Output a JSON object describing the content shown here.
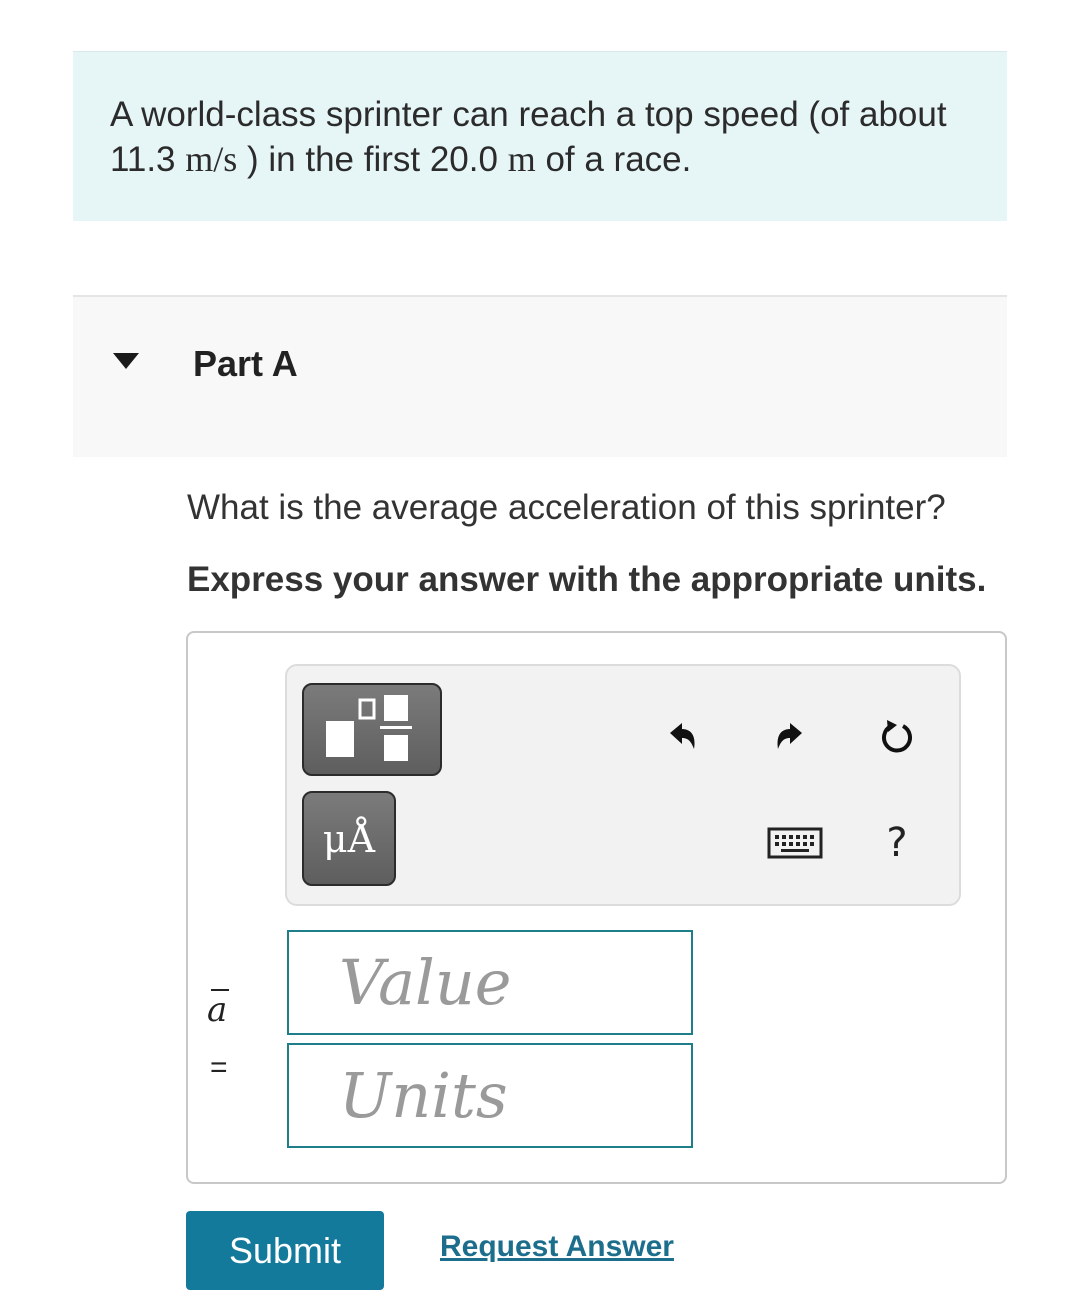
{
  "problem": {
    "text_1": "A world-class sprinter can reach a top speed (of about 11.3",
    "unit_speed": "m/s",
    "text_2": ") in the first 20.0",
    "unit_m": "m",
    "text_3": "of a race."
  },
  "part": {
    "title": "Part A"
  },
  "question": {
    "prompt": "What is the average acceleration of this sprinter?",
    "instruction": "Express your answer with the appropriate units."
  },
  "toolbar": {
    "units_button_label": "μÅ",
    "help_label": "?",
    "icons": [
      "templates-icon",
      "units-icon",
      "undo-icon",
      "redo-icon",
      "reset-icon",
      "keyboard-icon",
      "help-icon"
    ]
  },
  "answer": {
    "variable": "a",
    "equals": "=",
    "value_placeholder": "Value",
    "units_placeholder": "Units"
  },
  "actions": {
    "submit_label": "Submit",
    "request_label": "Request Answer"
  },
  "colors": {
    "intro_bg": "#e6f5f6",
    "submit_bg": "#147a9c",
    "field_border": "#1e7e8a",
    "link": "#1c6e8c"
  }
}
